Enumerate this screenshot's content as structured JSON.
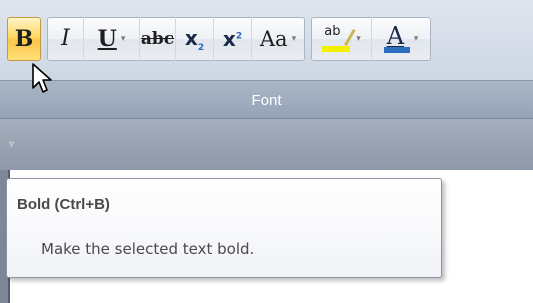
{
  "ribbon": {
    "group_label": "Font",
    "buttons": [
      {
        "glyph": "B",
        "tip": "bold"
      },
      {
        "glyph": "I",
        "tip": "italic"
      },
      {
        "glyph": "U",
        "tip": "underline"
      },
      {
        "glyph": "abc",
        "tip": "strikethrough"
      },
      {
        "glyph": "x",
        "sub": "2",
        "tip": "subscript"
      },
      {
        "glyph": "x",
        "sup": "2",
        "tip": "superscript"
      },
      {
        "glyph": "Aa",
        "tip": "change-case"
      },
      {
        "glyph": "ab",
        "tip": "text-highlight-color",
        "color": "#f5f000"
      },
      {
        "glyph": "A",
        "tip": "font-color",
        "color": "#2f6fc0"
      }
    ],
    "dropdown_arrow": "▾"
  },
  "quick_access": {
    "arrow": "▿"
  },
  "tooltip": {
    "title": "Bold (Ctrl+B)",
    "description": "Make the selected text bold."
  },
  "colors": {
    "pressed_button": "#ffd864",
    "highlight": "#f5f000",
    "font_color": "#2f6fc0",
    "group_label_bg": "#95a3b7"
  },
  "icons": [
    "pointer-cursor-icon",
    "dropdown-arrow-icon"
  ]
}
